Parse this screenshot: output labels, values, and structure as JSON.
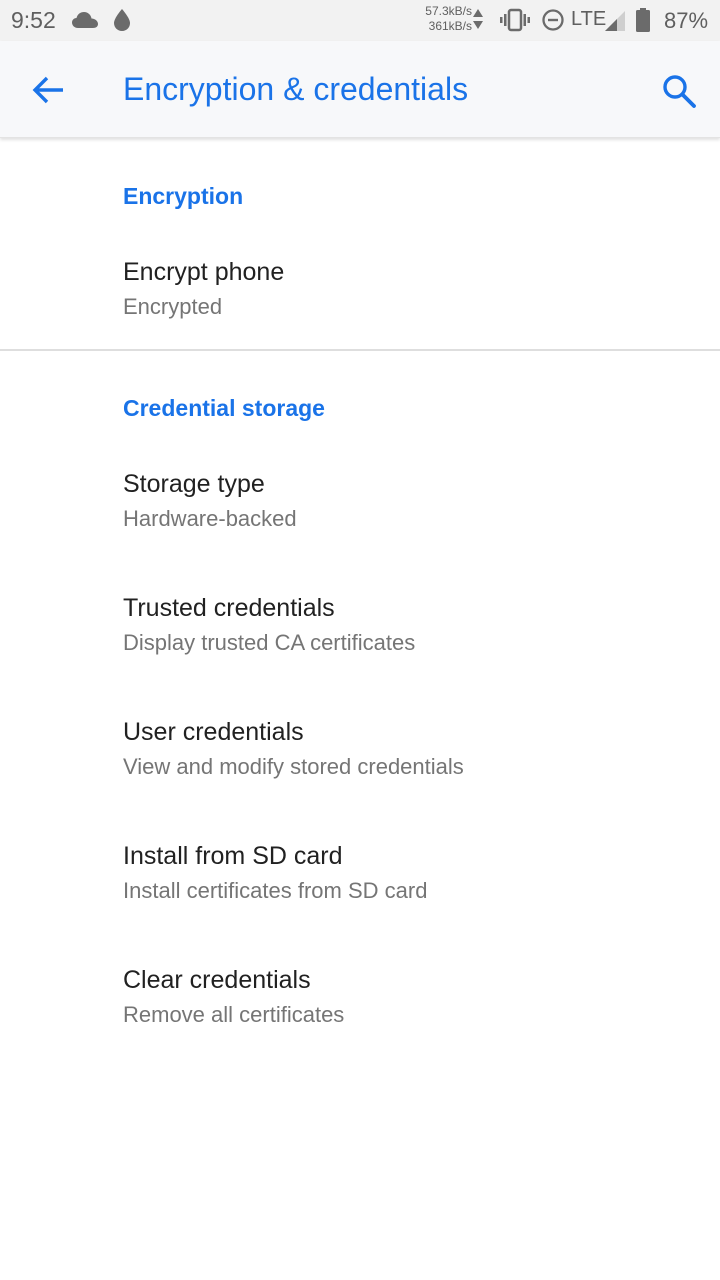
{
  "status_bar": {
    "time": "9:52",
    "speed_up": "57.3kB/s",
    "speed_down": "361kB/s",
    "network": "LTE",
    "battery": "87%",
    "icons": [
      "cloud-icon",
      "drop-icon",
      "vibrate-icon",
      "dnd-icon",
      "signal-icon",
      "battery-icon"
    ]
  },
  "app_bar": {
    "title": "Encryption & credentials",
    "back_icon": "arrow-back-icon",
    "search_icon": "search-icon"
  },
  "sections": {
    "encryption": {
      "header": "Encryption",
      "items": [
        {
          "title": "Encrypt phone",
          "summary": "Encrypted"
        }
      ]
    },
    "credential_storage": {
      "header": "Credential storage",
      "items": [
        {
          "title": "Storage type",
          "summary": "Hardware-backed"
        },
        {
          "title": "Trusted credentials",
          "summary": "Display trusted CA certificates"
        },
        {
          "title": "User credentials",
          "summary": "View and modify stored credentials"
        },
        {
          "title": "Install from SD card",
          "summary": "Install certificates from SD card"
        },
        {
          "title": "Clear credentials",
          "summary": "Remove all certificates"
        }
      ]
    }
  },
  "colors": {
    "accent": "#1a73e8",
    "title_text": "#212121",
    "summary_text": "#757575",
    "status_bar_bg": "#f2f2f2"
  }
}
